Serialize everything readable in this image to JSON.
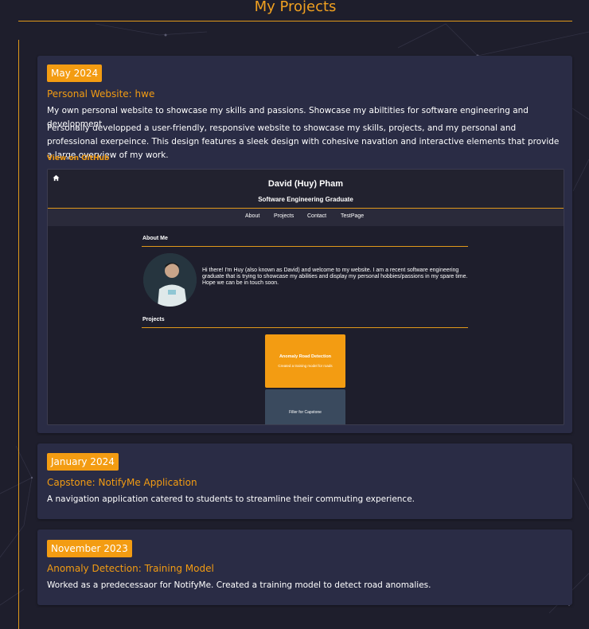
{
  "page": {
    "title": "My Projects"
  },
  "projects": [
    {
      "date": "May 2024",
      "title": "Personal Website: hwe",
      "description": [
        "My own personal website to showcase my skills and passions. Showcase my abiltities for software engineering and development.",
        "Personally developped a user-friendly, responsive website to showcase my skills, projects, and my personal and professional exerpeince. This design features a sleek design with cohesive navation and interactive elements that provide a large overview of my work."
      ],
      "link_label": "View on GitHub",
      "preview": {
        "home_icon": "home-icon",
        "name": "David (Huy) Pham",
        "subtitle": "Software Engineering Graduate",
        "nav": [
          "About",
          "Projects",
          "Contact",
          "TestPage"
        ],
        "about_heading": "About Me",
        "about_text": "Hi there! I'm Huy (also known as David) and welcome to my website. I am a recent software engineering graduate that is trying to showcase my abilities and display my personal hobbies/passions in my spare time. Hope we can be in touch soon.",
        "projects_heading": "Projects",
        "card_title": "Anomaly Road Detection",
        "card_desc": "Created a training model for roads",
        "filler": "Filler for Capstone"
      }
    },
    {
      "date": "January 2024",
      "title": "Capstone: NotifyMe Application",
      "description": [
        "A navigation application catered to students to streamline their commuting experience."
      ]
    },
    {
      "date": "November 2023",
      "title": "Anomaly Detection: Training Model",
      "description": [
        "Worked as a predecessaor for NotifyMe. Created a training model to detect road anomalies."
      ]
    }
  ],
  "colors": {
    "background": "#1e1e2c",
    "card": "#2a2c45",
    "accent": "#f39c12",
    "text": "#ffffff"
  }
}
